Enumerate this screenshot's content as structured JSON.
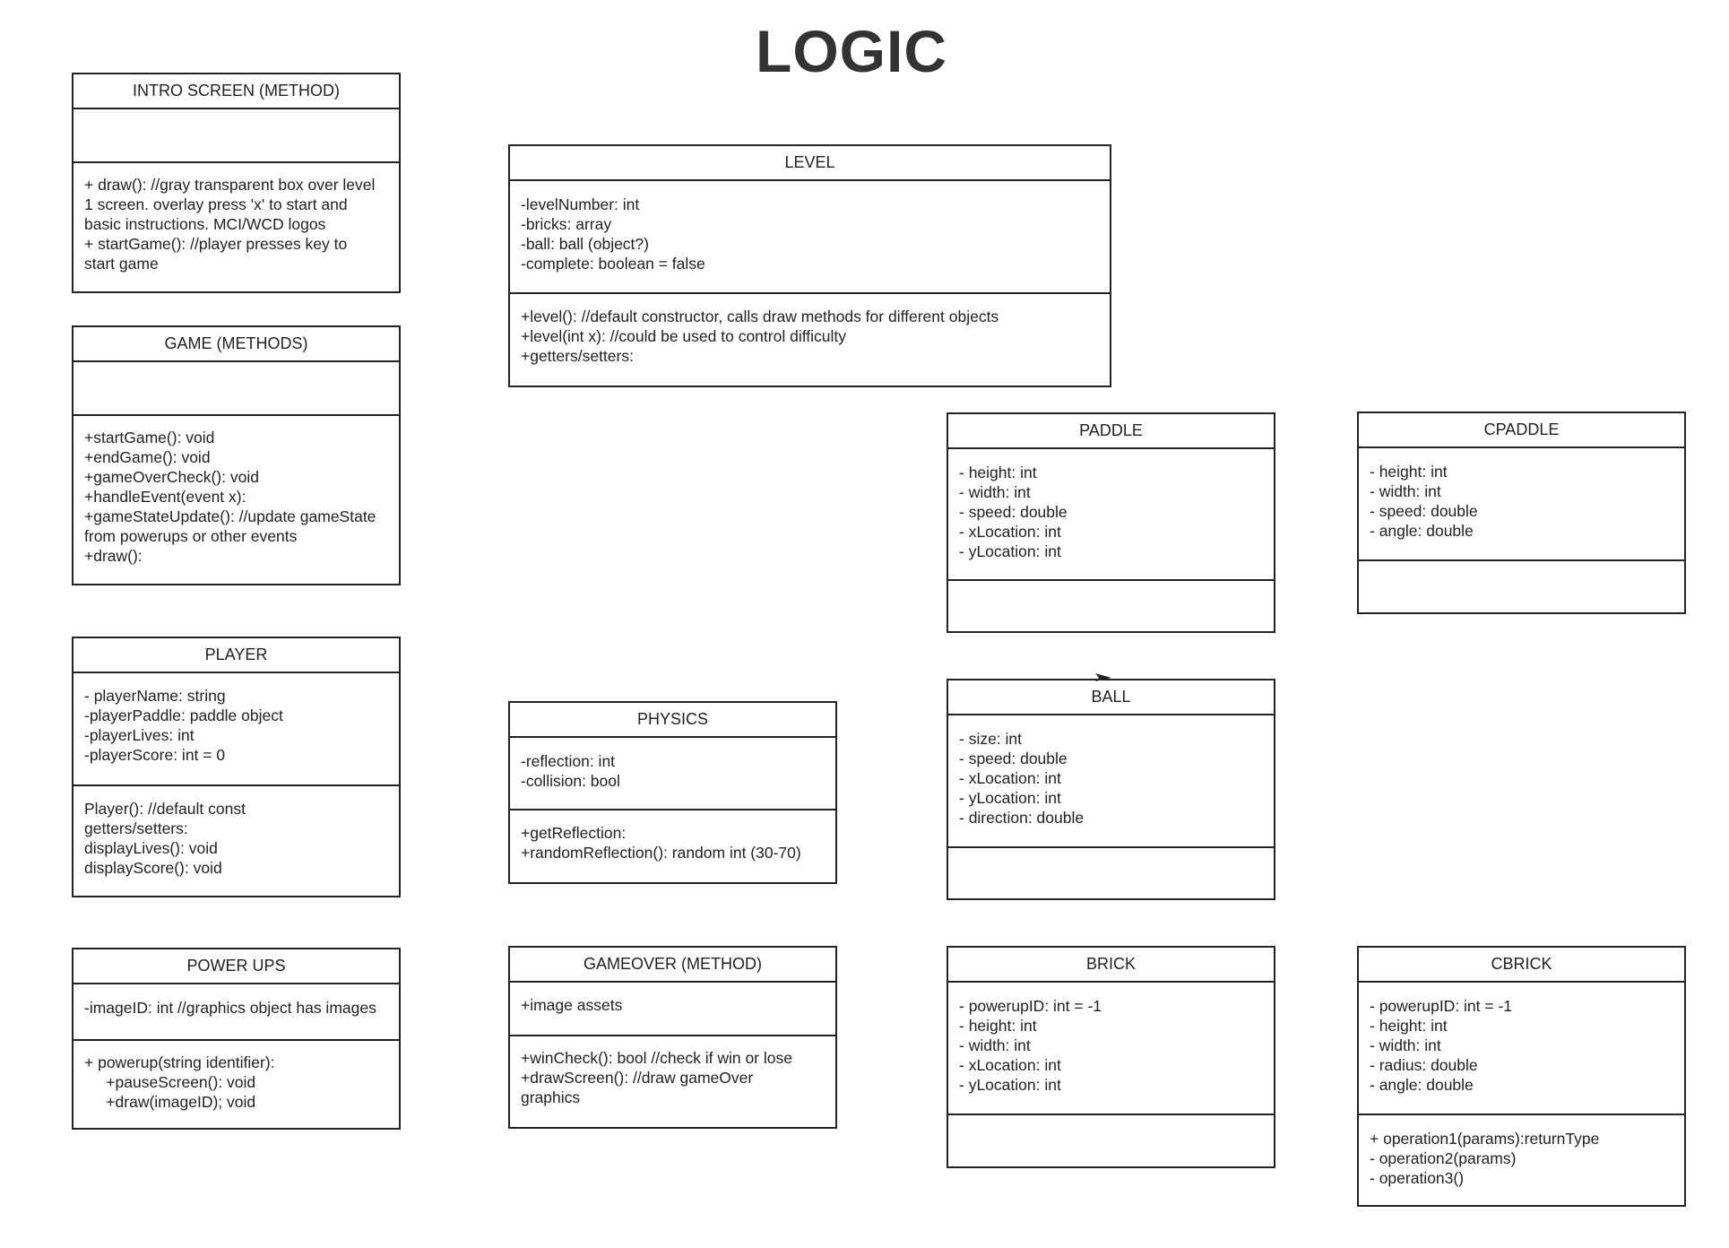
{
  "title": "LOGIC",
  "classes": {
    "intro_screen": {
      "name": "INTRO SCREEN (METHOD)",
      "attributes": [],
      "methods": [
        "+ draw(): //gray transparent box over level",
        "1 screen. overlay press 'x' to start and",
        "basic instructions. MCI/WCD logos",
        "+ startGame(): //player presses key to",
        "start game"
      ]
    },
    "game": {
      "name": "GAME (METHODS)",
      "attributes": [],
      "methods": [
        "+startGame(): void",
        "+endGame(): void",
        "+gameOverCheck(): void",
        "+handleEvent(event x):",
        "+gameStateUpdate(): //update gameState",
        "from powerups or other events",
        "+draw():"
      ]
    },
    "player": {
      "name": "PLAYER",
      "attributes": [
        "- playerName: string",
        "-playerPaddle: paddle object",
        "-playerLives: int",
        "-playerScore: int = 0"
      ],
      "methods": [
        "Player(): //default const",
        "getters/setters:",
        "displayLives(): void",
        "displayScore(): void"
      ]
    },
    "power_ups": {
      "name": "POWER UPS",
      "attributes": [
        "-imageID: int //graphics object has images"
      ],
      "methods": [
        "+ powerup(string identifier):",
        "     +pauseScreen(): void",
        "     +draw(imageID); void"
      ]
    },
    "level": {
      "name": "LEVEL",
      "attributes": [
        "-levelNumber: int",
        "-bricks: array",
        "-ball: ball (object?)",
        "-complete: boolean = false"
      ],
      "methods": [
        "+level(): //default constructor, calls draw methods for different objects",
        "+level(int x): //could be used to control difficulty",
        "+getters/setters:"
      ]
    },
    "physics": {
      "name": "PHYSICS",
      "attributes": [
        "-reflection: int",
        "-collision: bool"
      ],
      "methods": [
        "+getReflection:",
        "+randomReflection(): random int (30-70)"
      ]
    },
    "gameover": {
      "name": "GAMEOVER (METHOD)",
      "attributes": [
        "+image assets"
      ],
      "methods": [
        "+winCheck(): bool //check if win or lose",
        "+drawScreen(): //draw gameOver",
        "graphics"
      ]
    },
    "paddle": {
      "name": "PADDLE",
      "attributes": [
        "- height: int",
        "- width: int",
        "- speed: double",
        "- xLocation: int",
        "- yLocation: int"
      ],
      "methods": []
    },
    "ball": {
      "name": "BALL",
      "attributes": [
        "- size: int",
        "- speed: double",
        "- xLocation: int",
        "- yLocation: int",
        "- direction: double"
      ],
      "methods": []
    },
    "brick": {
      "name": "BRICK",
      "attributes": [
        "- powerupID: int = -1",
        "- height: int",
        "- width: int",
        "- xLocation: int",
        "- yLocation: int"
      ],
      "methods": []
    },
    "cpaddle": {
      "name": "CPADDLE",
      "attributes": [
        "- height: int",
        "- width: int",
        "- speed: double",
        "- angle: double"
      ],
      "methods": []
    },
    "cbrick": {
      "name": "CBRICK",
      "attributes": [
        "- powerupID: int = -1",
        "- height: int",
        "- width: int",
        "- radius: double",
        "- angle: double"
      ],
      "methods": [
        "+ operation1(params):returnType",
        "- operation2(params)",
        "- operation3()"
      ]
    }
  }
}
